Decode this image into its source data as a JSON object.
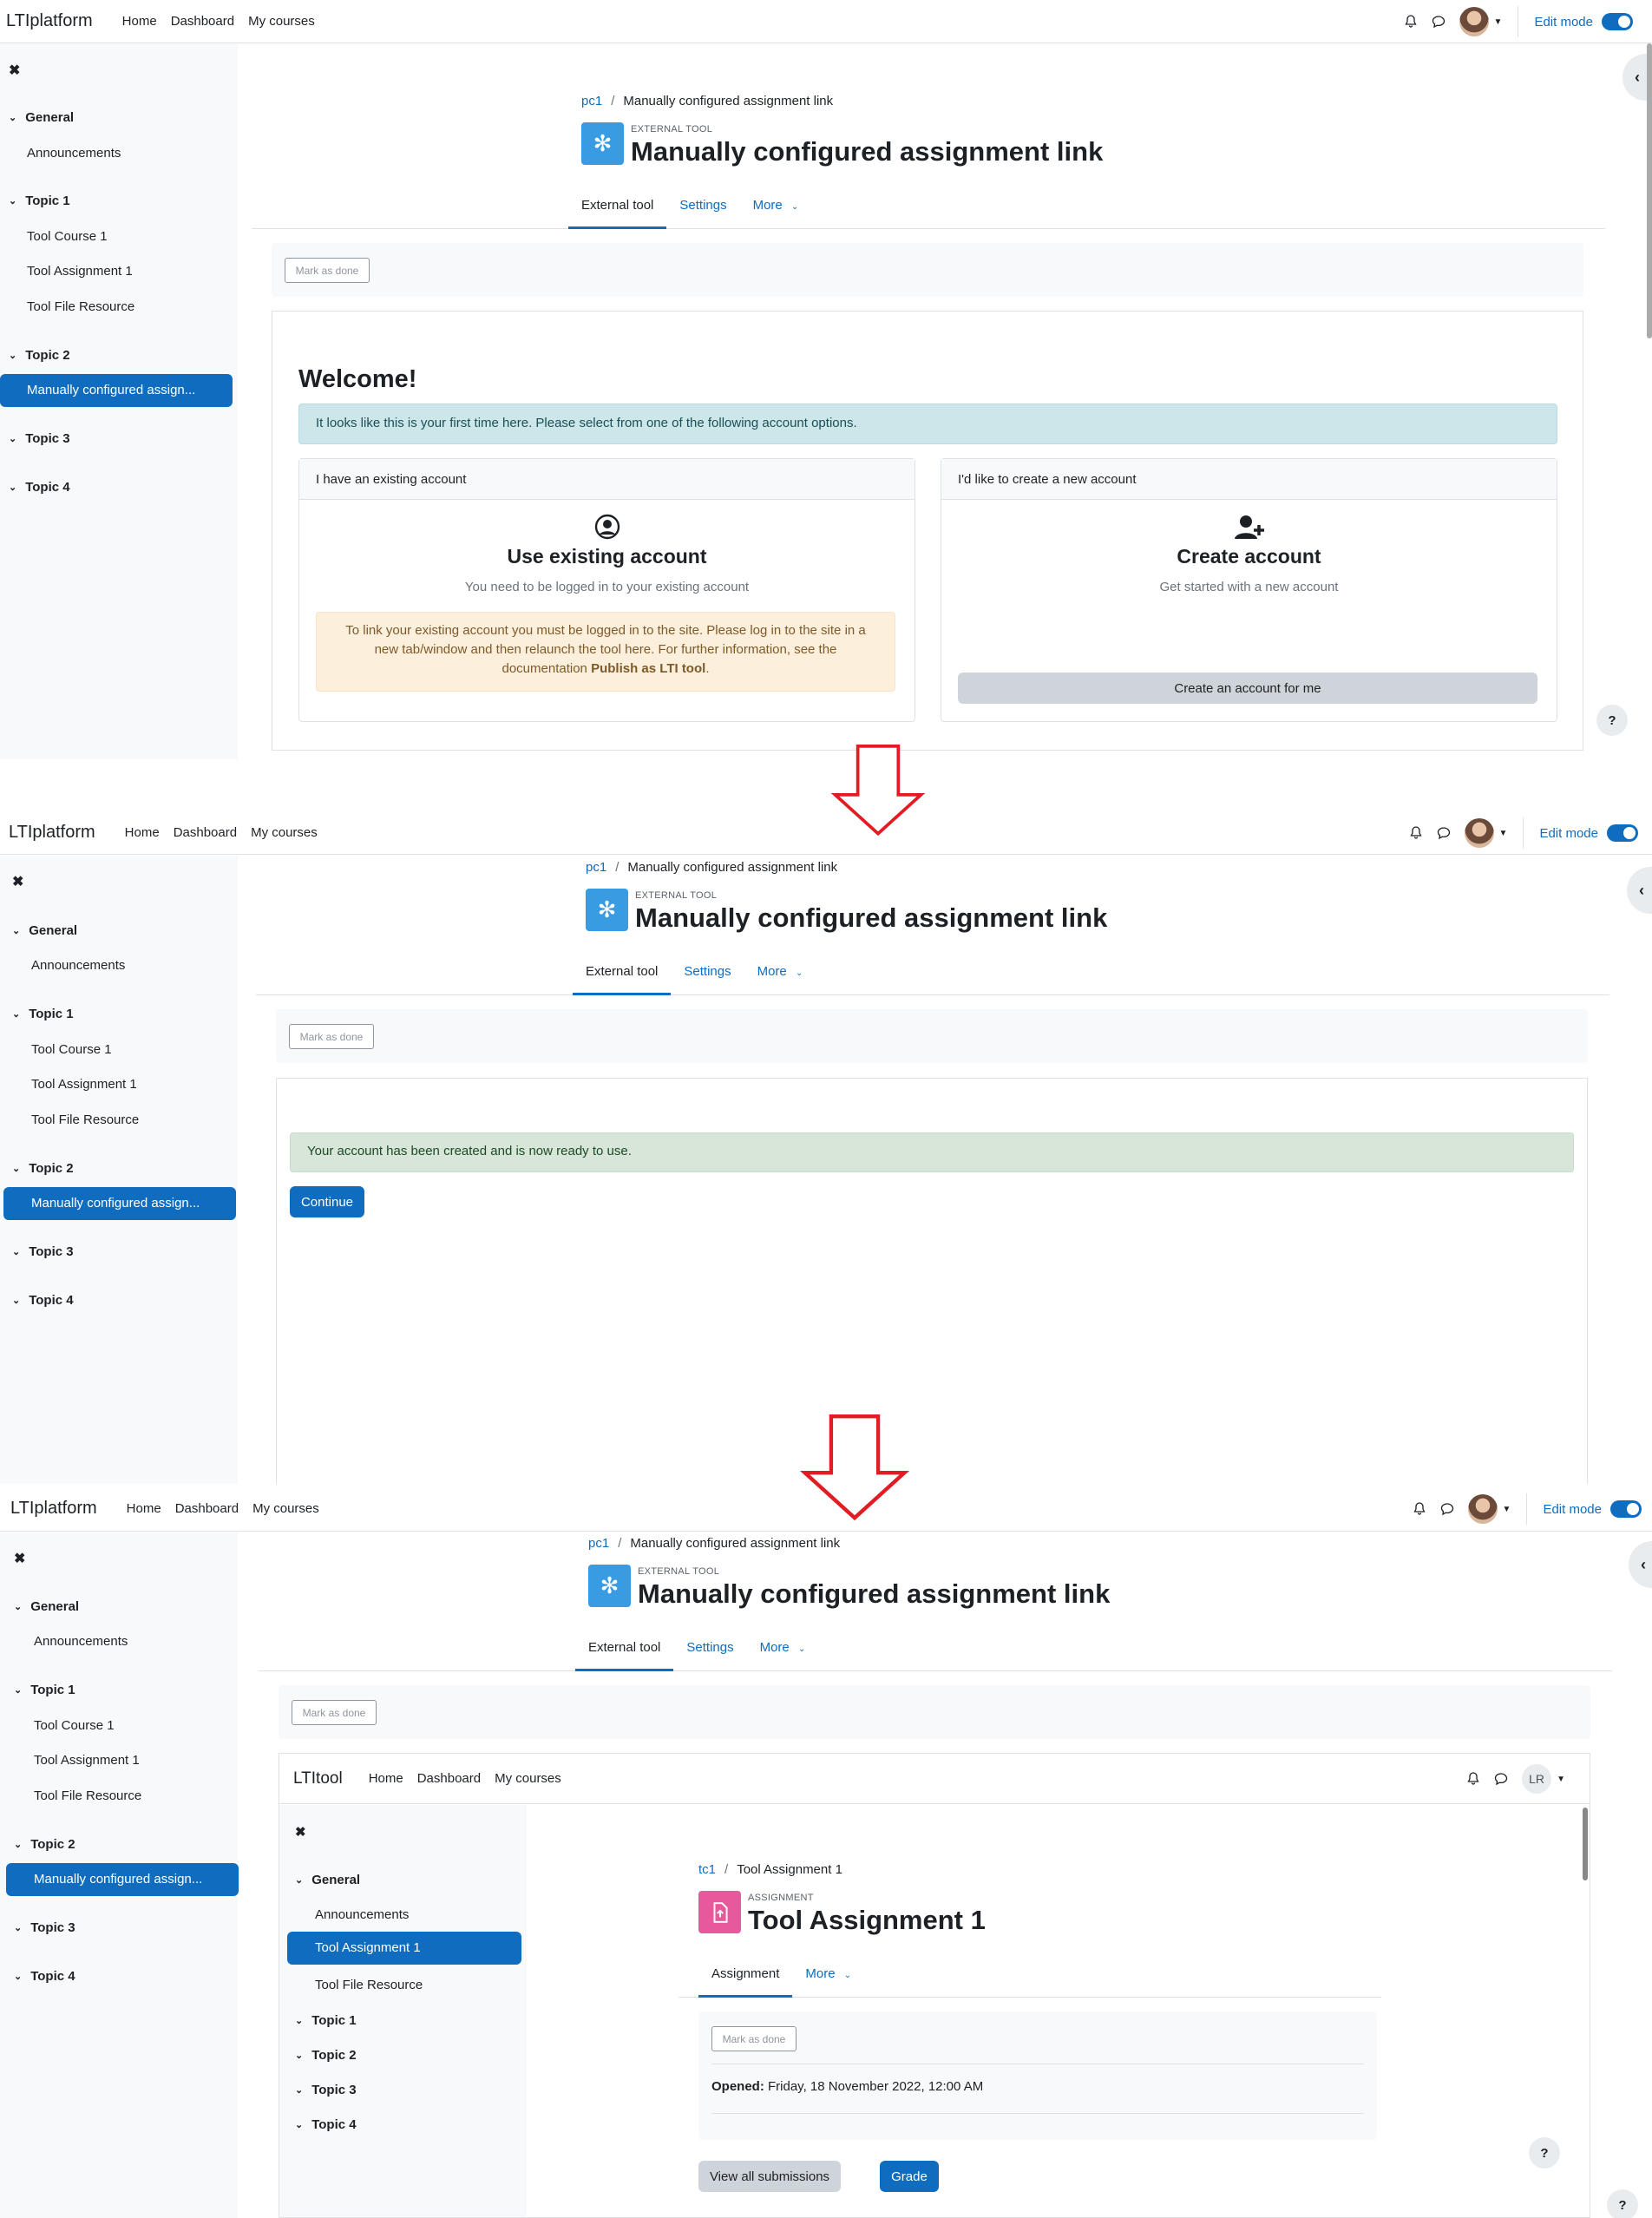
{
  "platform": {
    "brand": "LTIplatform",
    "nav": [
      "Home",
      "Dashboard",
      "My courses"
    ],
    "edit_mode": "Edit mode"
  },
  "drawer": {
    "sections": [
      {
        "title": "General",
        "items": [
          "Announcements"
        ]
      },
      {
        "title": "Topic 1",
        "items": [
          "Tool Course 1",
          "Tool Assignment 1",
          "Tool File Resource"
        ]
      },
      {
        "title": "Topic 2",
        "items": [
          "Manually configured assign..."
        ]
      },
      {
        "title": "Topic 3",
        "items": []
      },
      {
        "title": "Topic 4",
        "items": []
      }
    ]
  },
  "page": {
    "crumb_course": "pc1",
    "crumb_current": "Manually configured assignment link",
    "module_type": "EXTERNAL TOOL",
    "title": "Manually configured assignment link",
    "tabs": [
      "External tool",
      "Settings",
      "More"
    ],
    "mark_done": "Mark as done"
  },
  "step1": {
    "welcome": "Welcome!",
    "info": "It looks like this is your first time here. Please select from one of the following account options.",
    "existing": {
      "header": "I have an existing account",
      "title": "Use existing account",
      "subtitle": "You need to be logged in to your existing account",
      "warn_1": "To link your existing account you must be logged in to the site. Please log in to the site in a",
      "warn_2": "new tab/window and then relaunch the tool here. For further information, see the",
      "warn_3a": "documentation ",
      "warn_3b": "Publish as LTI tool",
      "warn_3c": "."
    },
    "create": {
      "header": "I'd like to create a new account",
      "title": "Create account",
      "subtitle": "Get started with a new account",
      "button": "Create an account for me"
    }
  },
  "step2": {
    "success": "Your account has been created and is now ready to use.",
    "continue": "Continue"
  },
  "tool": {
    "brand": "LTItool",
    "nav": [
      "Home",
      "Dashboard",
      "My courses"
    ],
    "user_initials": "LR",
    "sections_top": [
      {
        "title": "General",
        "items": [
          "Announcements",
          "Tool Assignment 1",
          "Tool File Resource"
        ]
      }
    ],
    "sections_rest": [
      "Topic 1",
      "Topic 2",
      "Topic 3",
      "Topic 4"
    ],
    "crumb_course": "tc1",
    "crumb_current": "Tool Assignment 1",
    "module_type": "ASSIGNMENT",
    "title": "Tool Assignment 1",
    "tabs": [
      "Assignment",
      "More"
    ],
    "mark_done": "Mark as done",
    "opened_label": "Opened:",
    "opened_value": " Friday, 18 November 2022, 12:00 AM",
    "view_all": "View all submissions",
    "grade": "Grade"
  },
  "help": "?",
  "colors": {
    "primary": "#0f6cbf",
    "arrow": "#e31b23",
    "assign_icon": "#e7589c"
  }
}
